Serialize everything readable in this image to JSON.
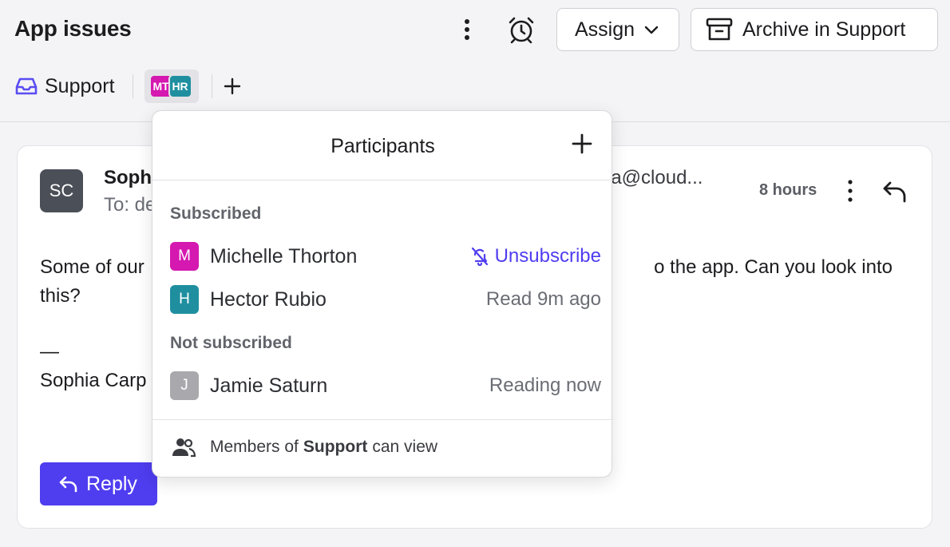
{
  "header": {
    "title": "App issues",
    "assign_label": "Assign",
    "archive_label": "Archive in Support",
    "inbox_label": "Support",
    "participant_initials": [
      "MT",
      "HR"
    ]
  },
  "message": {
    "sender_initials": "SC",
    "sender_name": "Soph",
    "to_line": "To: de",
    "email_fragment": "ia@cloud...",
    "time": "8 hours",
    "body_line1": "Some of our",
    "body_line1_tail": "o the app. Can you look into",
    "body_line2": "this?",
    "signature_dash": "—",
    "signature_name": "Sophia Carp",
    "reply_label": "Reply"
  },
  "participants": {
    "title": "Participants",
    "subscribed_label": "Subscribed",
    "not_subscribed_label": "Not subscribed",
    "subscribed": [
      {
        "initial": "M",
        "name": "Michelle Thorton",
        "status": "Unsubscribe",
        "color": "#d418b0"
      },
      {
        "initial": "H",
        "name": "Hector Rubio",
        "status": "Read 9m ago",
        "color": "#1f8fa0"
      }
    ],
    "not_subscribed": [
      {
        "initial": "J",
        "name": "Jamie Saturn",
        "status": "Reading now",
        "color": "#a9a9ad"
      }
    ],
    "footer_prefix": "Members of",
    "footer_team": "Support",
    "footer_suffix": "can view"
  },
  "colors": {
    "accent": "#4f3df0",
    "mt": "#d418b0",
    "hr": "#1f8fa0",
    "sender": "#4b4f58"
  }
}
